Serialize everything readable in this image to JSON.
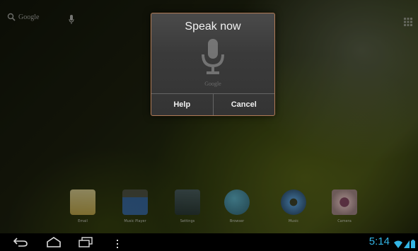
{
  "search": {
    "label": "Google"
  },
  "dialog": {
    "title": "Speak now",
    "brand": "Google",
    "help_label": "Help",
    "cancel_label": "Cancel"
  },
  "dock": {
    "apps": [
      {
        "label": "Email",
        "icon": "email-icon"
      },
      {
        "label": "Music Player",
        "icon": "clapper-icon"
      },
      {
        "label": "Settings",
        "icon": "settings-icon"
      },
      {
        "label": "Browser",
        "icon": "globe-icon"
      },
      {
        "label": "Music",
        "icon": "speaker-icon"
      },
      {
        "label": "Camera",
        "icon": "camera-icon"
      }
    ]
  },
  "status": {
    "time": "5:14"
  },
  "colors": {
    "accent": "#33b5e5",
    "dialog_border": "#b07a55"
  }
}
